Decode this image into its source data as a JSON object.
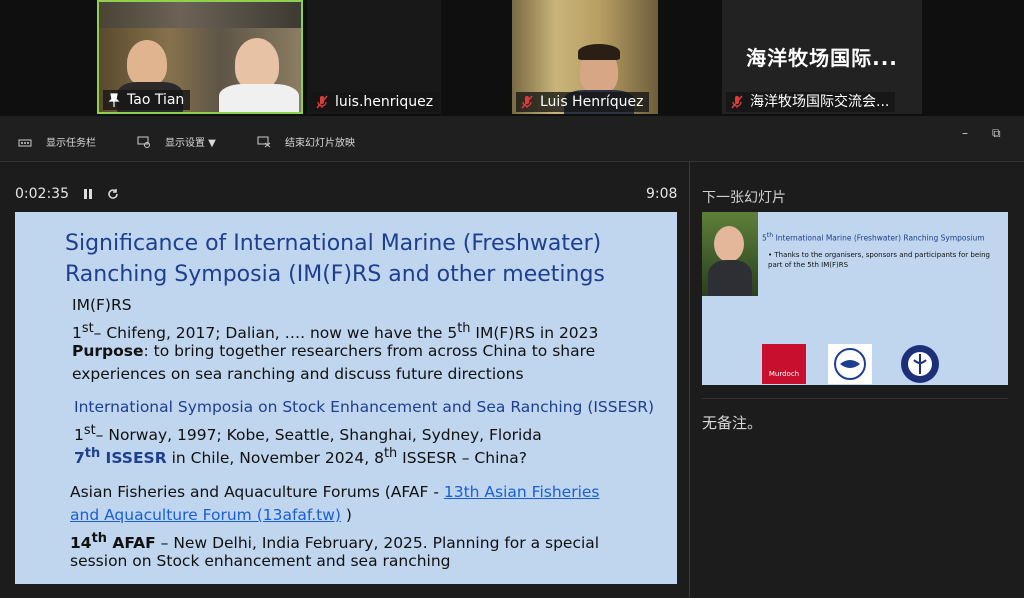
{
  "participants": [
    {
      "name": "Tao Tian",
      "pinned": true,
      "muted": false
    },
    {
      "name": "luis.henriquez",
      "muted": true
    },
    {
      "name": "Luis Henríquez",
      "muted": true
    },
    {
      "name": "海洋牧场国际交流会...",
      "muted": true,
      "display_text": "海洋牧场国际..."
    }
  ],
  "toolbar": {
    "show_taskbar": "显示任务栏",
    "display_settings": "显示设置 ▼",
    "end_slideshow": "结束幻灯片放映"
  },
  "presenter": {
    "elapsed": "0:02:35",
    "clock": "9:08",
    "next_slide_label": "下一张幻灯片",
    "notes": "无备注。"
  },
  "slide": {
    "title_line1": "Significance of International Marine (Freshwater)",
    "title_line2": "Ranching Symposia (IM(F)RS and other meetings",
    "imfrs_heading": "IM(F)RS",
    "imfrs_line1_sup": "st",
    "imfrs_line1_a": "1",
    "imfrs_line1_b": "– Chifeng, 2017; Dalian, …. now we have the 5",
    "imfrs_line1_sup2": "th",
    "imfrs_line1_c": " IM(F)RS in 2023",
    "purpose_label": "Purpose",
    "purpose_text": ": to bring together researchers from across China to share",
    "purpose_text2": "experiences on sea ranching and discuss future directions",
    "issesr_heading": "International Symposia on Stock Enhancement and Sea Ranching (ISSESR)",
    "issesr_line1_a": "1",
    "issesr_line1_sup": "st",
    "issesr_line1_b": "– Norway, 1997; Kobe, Seattle, Shanghai, Sydney, Florida",
    "issesr_line2_a": "7",
    "issesr_line2_sup": "th",
    "issesr_line2_b": " ISSESR",
    "issesr_line2_c": " in Chile, November 2024, 8",
    "issesr_line2_sup2": "th",
    "issesr_line2_d": " ISSESR – China?",
    "afaf_line1": "Asian Fisheries and Aquaculture Forums (AFAF - ",
    "afaf_link1": "13th Asian Fisheries",
    "afaf_link2": "and Aquaculture Forum (13afaf.tw)",
    "afaf_line2_end": " )",
    "afaf_line3_a": "14",
    "afaf_line3_sup": "th",
    "afaf_line3_b": " AFAF",
    "afaf_line3_c": " – New Delhi, India February, 2025. Planning for a special",
    "afaf_line4": "session on Stock enhancement and sea ranching"
  },
  "next_slide": {
    "title_a": "5",
    "title_sup": "th",
    "title_b": " International Marine (Freshwater) Ranching Symposium",
    "bullet": "Thanks to the organisers, sponsors and participants for being part of the 5th IM(F)RS",
    "logo1": "Murdoch"
  },
  "colors": {
    "slide_bg": "#bfd6ee",
    "title_blue": "#1e3f8f",
    "active_speaker_border": "#8fd14f",
    "mute_red": "#e03c3c"
  }
}
